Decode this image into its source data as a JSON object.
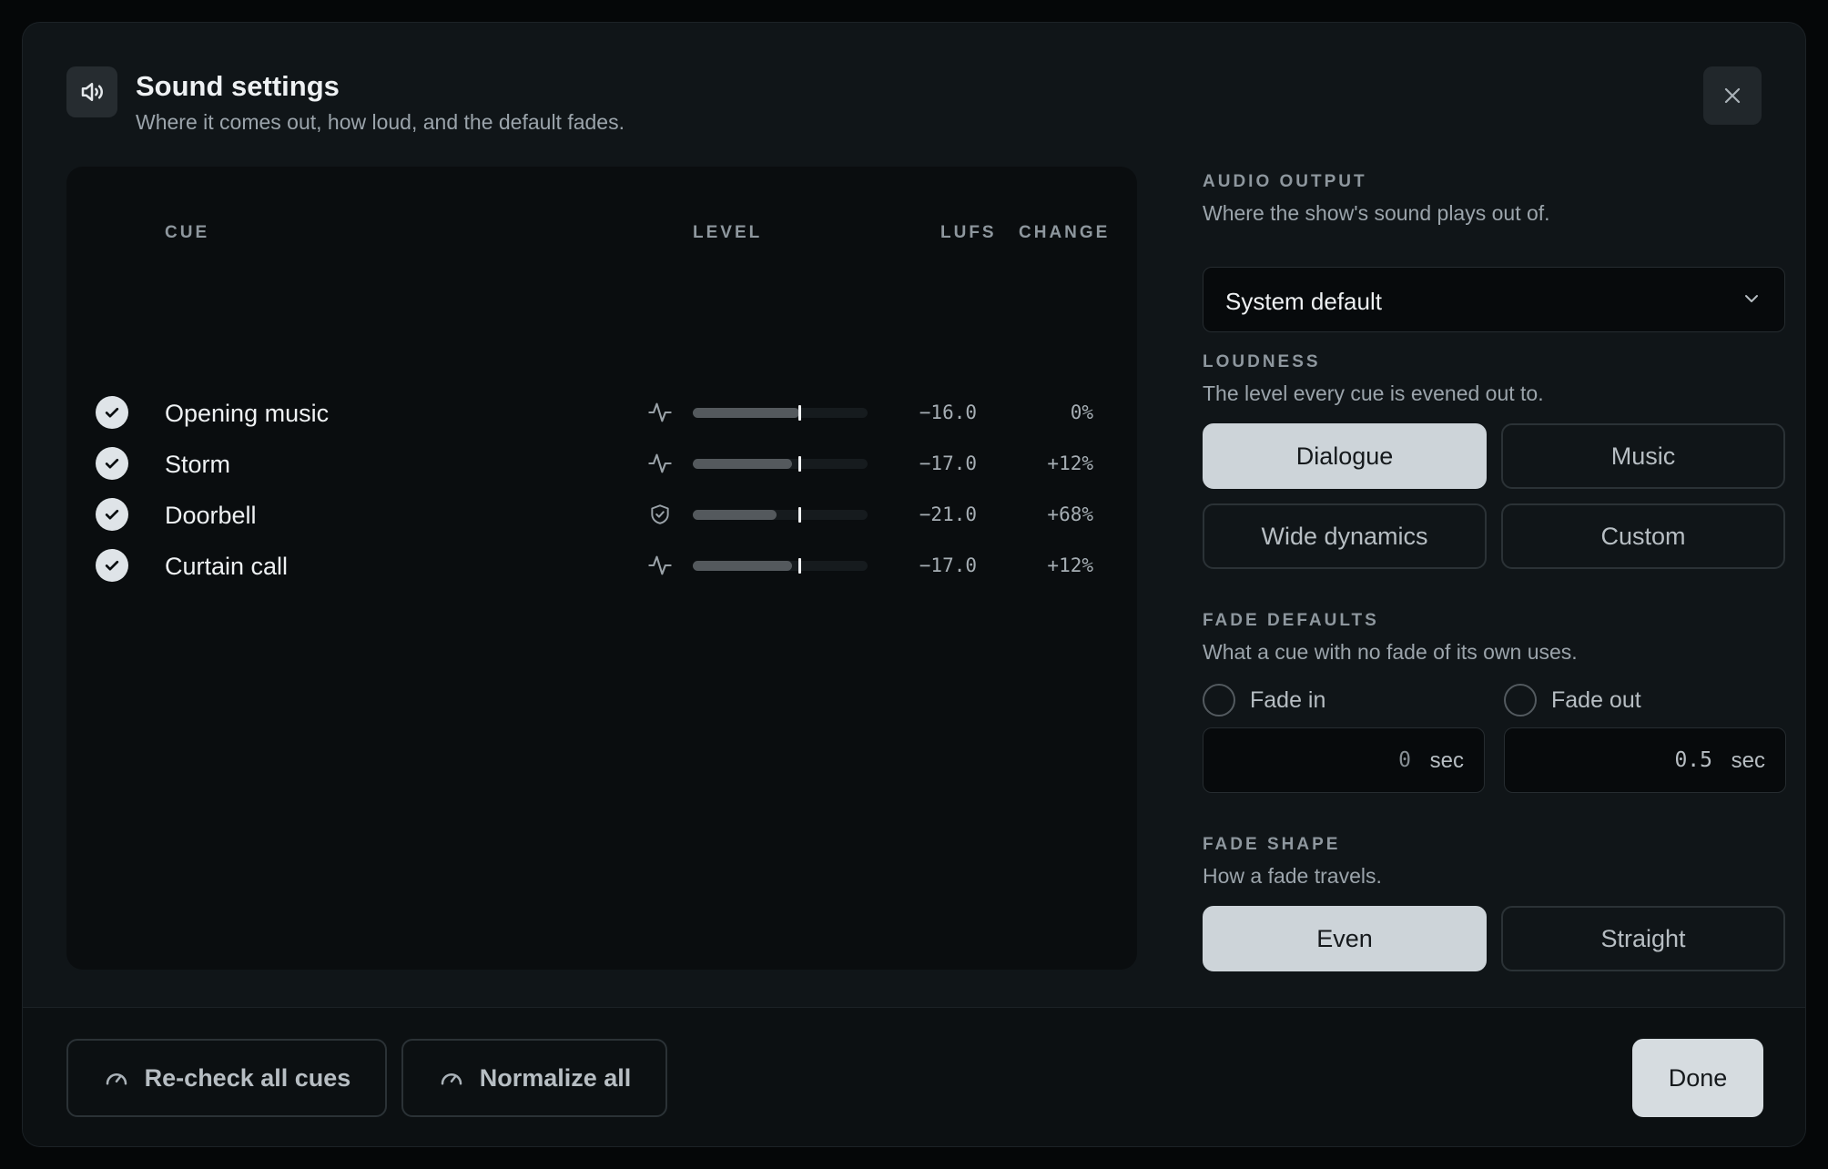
{
  "header": {
    "title": "Sound settings",
    "subtitle": "Where it comes out, how loud, and the default fades.",
    "icon": "speaker-icon",
    "close_icon": "close-icon"
  },
  "cues": {
    "columns": {
      "cue": "CUE",
      "level": "LEVEL",
      "lufs": "LUFS",
      "change": "CHANGE"
    },
    "rows": [
      {
        "name": "Opening music",
        "icon": "waveform-icon",
        "level_fraction": 0.61,
        "lufs": "−16.0",
        "change": "0%",
        "checked": true
      },
      {
        "name": "Storm",
        "icon": "waveform-icon",
        "level_fraction": 0.57,
        "lufs": "−17.0",
        "change": "+12%",
        "checked": true
      },
      {
        "name": "Doorbell",
        "icon": "shield-icon",
        "level_fraction": 0.48,
        "lufs": "−21.0",
        "change": "+68%",
        "checked": true
      },
      {
        "name": "Curtain call",
        "icon": "waveform-icon",
        "level_fraction": 0.57,
        "lufs": "−17.0",
        "change": "+12%",
        "checked": true
      }
    ]
  },
  "audio_output": {
    "label": "AUDIO OUTPUT",
    "description": "Where the show's sound plays out of.",
    "selected": "System default"
  },
  "loudness": {
    "label": "LOUDNESS",
    "description": "The level every cue is evened out to.",
    "options": [
      "Dialogue",
      "Music",
      "Wide dynamics",
      "Custom"
    ],
    "selected": "Dialogue"
  },
  "fade_defaults": {
    "label": "FADE DEFAULTS",
    "description": "What a cue with no fade of its own uses.",
    "fade_in": {
      "label": "Fade in",
      "value": "0",
      "unit": "sec",
      "checked": false
    },
    "fade_out": {
      "label": "Fade out",
      "value": "0.5",
      "unit": "sec",
      "checked": false
    }
  },
  "fade_shape": {
    "label": "FADE SHAPE",
    "description": "How a fade travels.",
    "options": [
      "Even",
      "Straight"
    ],
    "selected": "Even"
  },
  "footer": {
    "recheck_label": "Re-check all cues",
    "normalize_label": "Normalize all",
    "done_label": "Done"
  },
  "colors": {
    "background": "#101518",
    "active_segment": "#cdd4d9",
    "meter_fill": "#54595d",
    "meter_target": "#f0f2f4"
  }
}
